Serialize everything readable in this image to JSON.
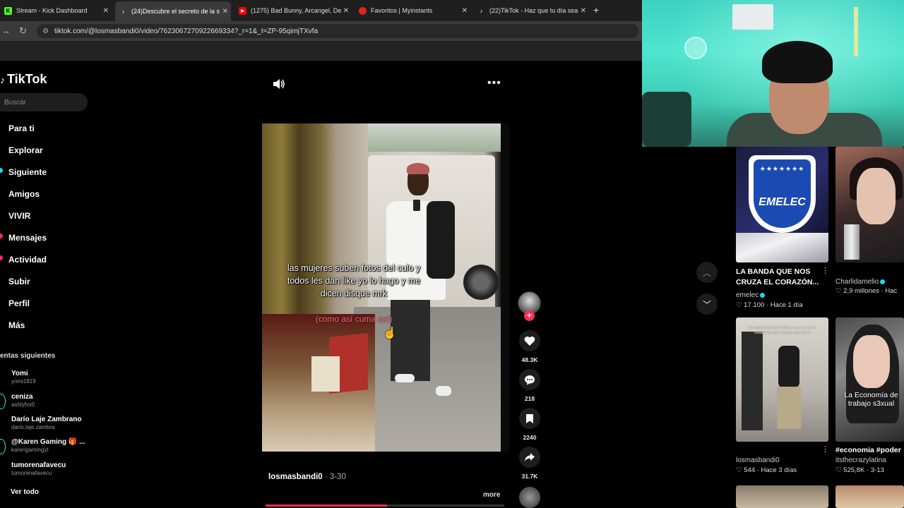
{
  "browser": {
    "tabs": [
      {
        "title": "Stream - Kick Dashboard",
        "icon": "kick-icon",
        "color": "#53fc18"
      },
      {
        "title": "(24)Descubre el secreto de la s",
        "icon": "tiktok-icon",
        "color": "#ffffff"
      },
      {
        "title": "(1275) Bad Bunny, Arcangel, De",
        "icon": "youtube-icon",
        "color": "#ff0000"
      },
      {
        "title": "Favoritos | Myinstants",
        "icon": "myinstants-icon",
        "color": "#e2231a"
      },
      {
        "title": "(22)TikTok - Haz que tu día sea",
        "icon": "tiktok-icon",
        "color": "#ffffff"
      }
    ],
    "new_tab": "+",
    "url": "tiktok.com/@losmasbandi0/video/7623067270922669334?_r=1&_t=ZP-95qimjTXvfa"
  },
  "sidebar": {
    "logo": "TikTok",
    "search_placeholder": "Buscar",
    "nav": [
      {
        "label": "Para ti",
        "dot": ""
      },
      {
        "label": "Explorar",
        "dot": ""
      },
      {
        "label": "Siguiente",
        "dot": "#20d5ec"
      },
      {
        "label": "Amigos",
        "dot": ""
      },
      {
        "label": "VIVIR",
        "dot": ""
      },
      {
        "label": "Mensajes",
        "dot": "#fe2c55"
      },
      {
        "label": "Actividad",
        "dot": "#fe2c55"
      },
      {
        "label": "Subir",
        "dot": ""
      },
      {
        "label": "Perfil",
        "dot": ""
      },
      {
        "label": "Más",
        "dot": ""
      }
    ],
    "following_title": "entas siguientes",
    "accounts": [
      {
        "name": "Yomi",
        "handle": "yomi1819"
      },
      {
        "name": "ceniza",
        "handle": "ashlyfxx0"
      },
      {
        "name": "Darío Laje Zambrano",
        "handle": "dario.laje.zambra"
      },
      {
        "name": "@Karen Gaming 🎁 ...",
        "handle": "karengamingyt"
      },
      {
        "name": "tumorenafavecu",
        "handle": "tumorenafavecu"
      }
    ],
    "see_all": "Ver todo"
  },
  "video": {
    "caption": "las mujeres suben fotos del culo y todos les dan like yo lo hago y me dicen disque mrk",
    "caption_red": "(como así cuma así)",
    "author": "losmasbandi0",
    "date": "· 3-30",
    "more": "more",
    "progress": 0.51,
    "likes": "48.3K",
    "comments": "218",
    "saves": "2240",
    "shares": "31.7K",
    "follow_plus": "+"
  },
  "feed": {
    "cards": [
      {
        "title": "LA BANDA QUE NOS CRUZA EL CORAZÓN...",
        "author": "emelec",
        "verified": true,
        "likes": "17.100",
        "time": "Hace 1 día",
        "image_text": "EMELEC"
      },
      {
        "title": "",
        "author": "Charlidamelio",
        "verified": true,
        "likes": "2,9 millones",
        "time": "Hac",
        "image_text": ""
      },
      {
        "title": "",
        "author": "losmasbandi0",
        "verified": false,
        "likes": "544",
        "time": "Hace 3 días",
        "image_text": "La explicación del video en que la fue a robarle al pobre tienda que tiene"
      },
      {
        "title": "#economia #poder",
        "author": "itsthecrazylatina",
        "verified": false,
        "likes": "525,8K",
        "time": "3-13",
        "image_text": "La Economía de trabajo s3xual"
      }
    ],
    "heart": "♡"
  }
}
